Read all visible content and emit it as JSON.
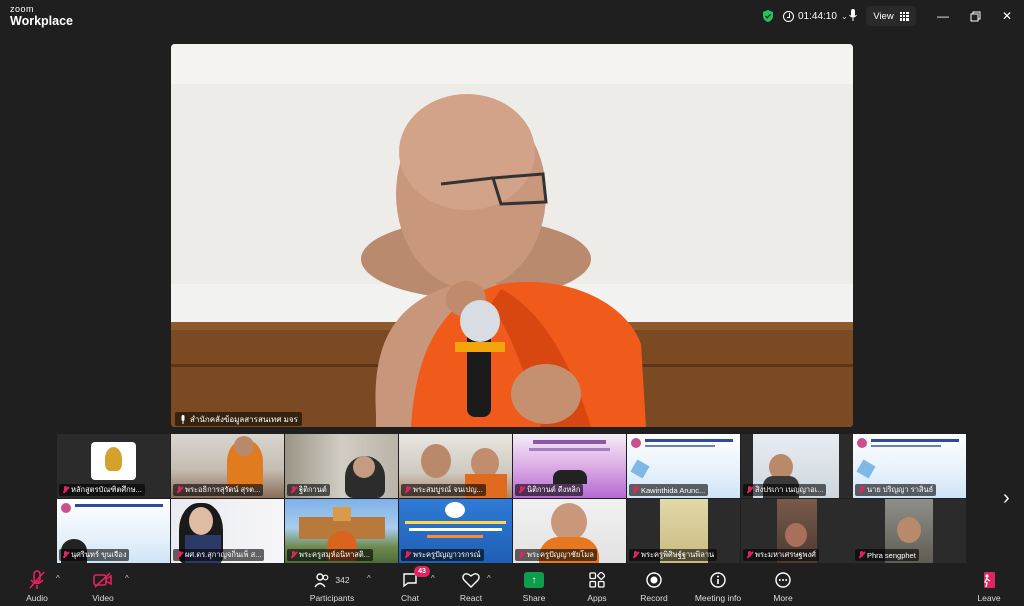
{
  "app": {
    "brand_top": "zoom",
    "brand_bottom": "Workplace"
  },
  "titlebar": {
    "timer": "01:44:10",
    "view_label": "View",
    "security_color": "#22c55e"
  },
  "speaker": {
    "name": "สำนักคลังข้อมูลสารสนเทศ มจร",
    "robe_color": "#f05a1a"
  },
  "gallery": {
    "tiles": [
      {
        "name": "หลักสูตรบัณฑิตศึกษ..."
      },
      {
        "name": "พระอธิการสุรัตน์ สุรต..."
      },
      {
        "name": "ฐิติกานต์"
      },
      {
        "name": "พระสมบูรณ์ จนเปญ..."
      },
      {
        "name": "นิติกานต์ ดีงหลิก"
      },
      {
        "name": "Kawinthida Arunc..."
      },
      {
        "name": "สิงปรเกา เนญญาอเ..."
      },
      {
        "name": "นาย ปริญญา ราสินธ์"
      },
      {
        "name": "นุศรินทร์ ขุนเจือง"
      },
      {
        "name": "ผศ.ดร.สุกาญจกิ่นเพ็ ส..."
      },
      {
        "name": "พระครูสมุห์อนิหาสติ..."
      },
      {
        "name": "พระครูปัญญาวรกรณ์"
      },
      {
        "name": "พระครูปัญญาชัยโมล"
      },
      {
        "name": "พระครูพิศิษฐ์ฐานพิลาน"
      },
      {
        "name": "พระมหาเศรษฐพงศ์"
      },
      {
        "name": "Phra sengphet"
      }
    ]
  },
  "toolbar": {
    "audio": "Audio",
    "video": "Video",
    "participants": "Participants",
    "participants_count": "342",
    "chat": "Chat",
    "chat_badge": "43",
    "react": "React",
    "share": "Share",
    "apps": "Apps",
    "record": "Record",
    "meeting_info": "Meeting info",
    "more": "More",
    "leave": "Leave",
    "share_color": "#0e9d4b",
    "leave_color": "#e0245e"
  }
}
